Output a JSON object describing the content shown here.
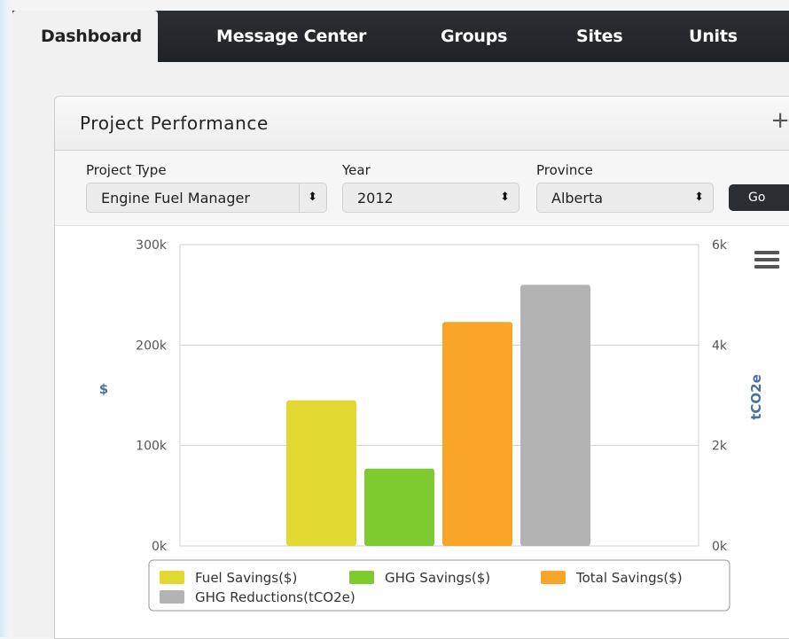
{
  "nav": {
    "tabs": [
      {
        "label": "Dashboard",
        "active": true
      },
      {
        "label": "Message Center"
      },
      {
        "label": "Groups"
      },
      {
        "label": "Sites"
      },
      {
        "label": "Units"
      }
    ]
  },
  "panel": {
    "title": "Project Performance",
    "expand_icon": "plus-icon"
  },
  "filters": {
    "project_type": {
      "label": "Project Type",
      "value": "Engine Fuel Manager"
    },
    "year": {
      "label": "Year",
      "value": "2012"
    },
    "province": {
      "label": "Province",
      "value": "Alberta"
    },
    "go_label": "Go"
  },
  "chart_data": {
    "type": "bar",
    "categories": [
      "Fuel Savings($)",
      "GHG Savings($)",
      "Total Savings($)",
      "GHG Reductions(tCO2e)"
    ],
    "series": [
      {
        "name": "Fuel Savings($)",
        "axis": "left",
        "value": 145000,
        "color": "#e2d832"
      },
      {
        "name": "GHG Savings($)",
        "axis": "left",
        "value": 77000,
        "color": "#7ecb30"
      },
      {
        "name": "Total Savings($)",
        "axis": "left",
        "value": 223000,
        "color": "#f9a529"
      },
      {
        "name": "GHG Reductions(tCO2e)",
        "axis": "right",
        "value": 5200,
        "color": "#b3b3b3"
      }
    ],
    "ylabel": "$",
    "y2label": "tCO2e",
    "ylim": [
      0,
      300000
    ],
    "y2lim": [
      0,
      6000
    ],
    "yticks": [
      "0k",
      "100k",
      "200k",
      "300k"
    ],
    "y2ticks": [
      "0k",
      "2k",
      "4k",
      "6k"
    ],
    "grid": true,
    "legend_placement": "bottom",
    "menu_icon": "hamburger-menu-icon"
  }
}
